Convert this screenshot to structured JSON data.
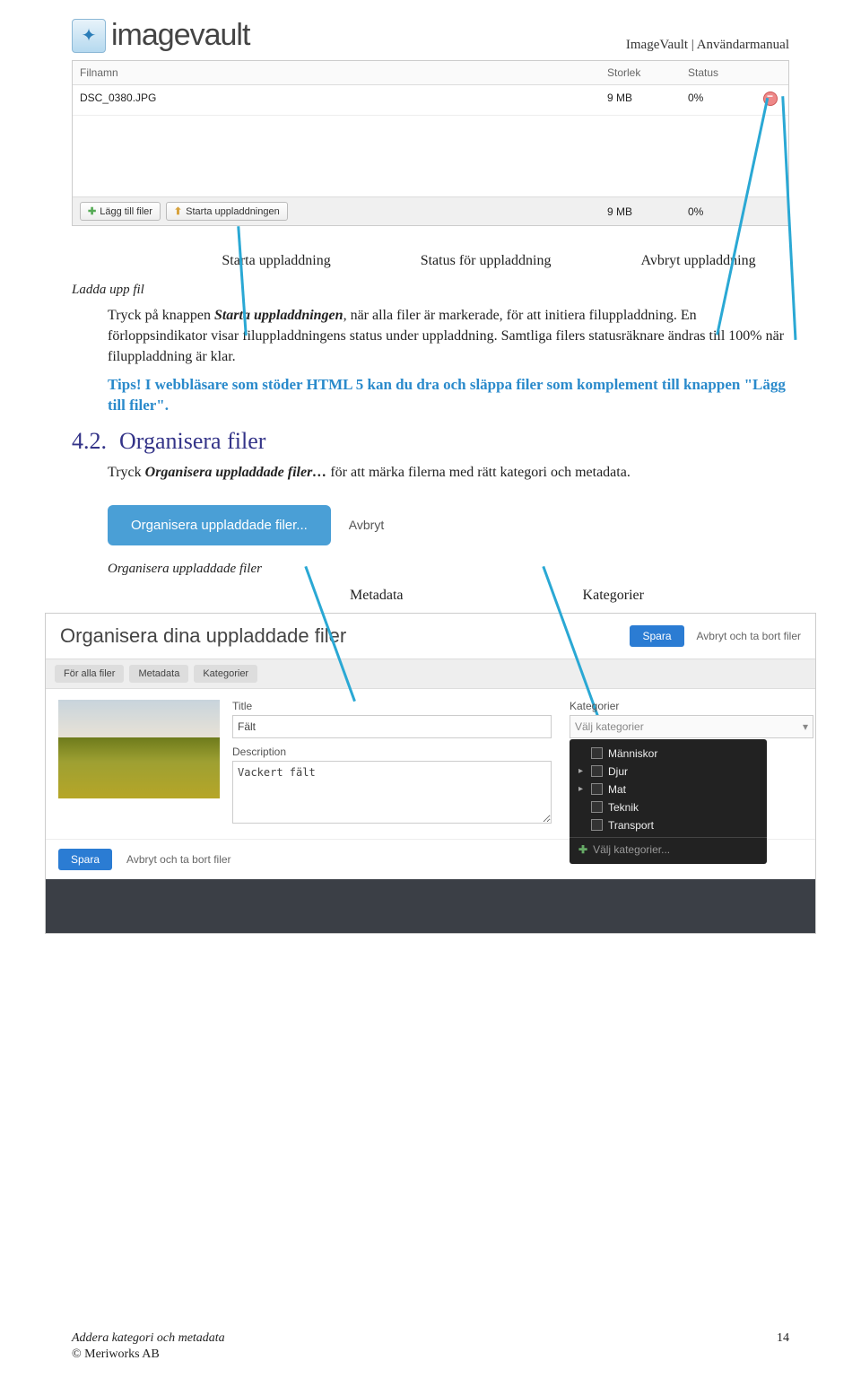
{
  "header": {
    "logo_text": "imagevault",
    "doc_title": "ImageVault | Användarmanual"
  },
  "upload": {
    "cols": {
      "name": "Filnamn",
      "size": "Storlek",
      "status": "Status"
    },
    "row": {
      "name": "DSC_0380.JPG",
      "size": "9 MB",
      "status": "0%"
    },
    "footer": {
      "add": "Lägg till filer",
      "start": "Starta uppladdningen",
      "size": "9 MB",
      "status": "0%"
    }
  },
  "callouts": {
    "c1": "Starta uppladdning",
    "c2": "Status för uppladdning",
    "c3": "Avbryt uppladdning"
  },
  "caption1": "Ladda upp fil",
  "p1a": "Tryck på knappen ",
  "p1b": "Starta uppladdningen",
  "p1c": ", när alla filer är markerade, för att initiera filuppladdning. En förloppsindikator visar filuppladdningens status under uppladdning. Samtliga filers statusräknare ändras till 100% när filuppladdning är klar.",
  "tips_label": "Tips!",
  "tips_text": "  I webbläsare som stöder HTML 5 kan du dra och släppa filer som komplement till knappen \"Lägg till filer\".",
  "section": {
    "num": "4.2.",
    "title": "Organisera filer"
  },
  "p2a": "Tryck ",
  "p2b": "Organisera uppladdade filer…",
  "p2c": " för att märka filerna med rätt kategori och metadata.",
  "orgrow": {
    "btn": "Organisera uppladdade filer...",
    "cancel": "Avbryt"
  },
  "caption2": "Organisera uppladdade filer",
  "mk": {
    "m": "Metadata",
    "k": "Kategorier"
  },
  "panel": {
    "heading": "Organisera dina uppladdade filer",
    "save": "Spara",
    "cancel_remove": "Avbryt och ta bort filer",
    "tabs": {
      "all": "För alla filer",
      "meta": "Metadata",
      "cat": "Kategorier"
    },
    "title_lbl": "Title",
    "title_val": "Fält",
    "desc_lbl": "Description",
    "desc_val": "Vackert fält",
    "cat_lbl": "Kategorier",
    "cat_ph": "Välj kategorier",
    "cats": {
      "c1": "Människor",
      "c2": "Djur",
      "c3": "Mat",
      "c4": "Teknik",
      "c5": "Transport",
      "add": "Välj kategorier..."
    },
    "foot_save": "Spara",
    "foot_cancel": "Avbryt och ta bort filer"
  },
  "caption3": "Addera kategori och metadata",
  "footer": {
    "copyright": "© Meriworks AB",
    "page": "14"
  }
}
